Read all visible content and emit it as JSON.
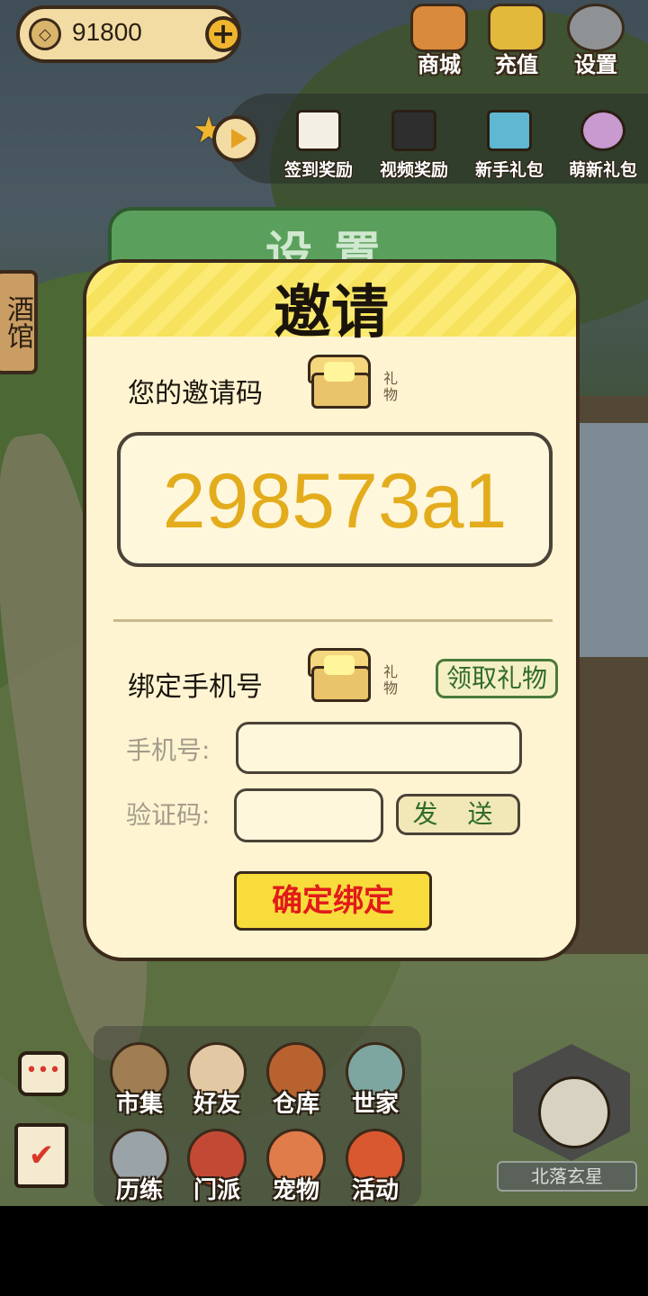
{
  "top_bar": {
    "coins": "91800",
    "coin_icon": "diamond-coin-icon",
    "buttons": [
      {
        "label": "商城",
        "icon": "shop-bag-icon"
      },
      {
        "label": "充值",
        "icon": "recharge-gold-icon"
      },
      {
        "label": "设置",
        "icon": "gear-icon"
      }
    ]
  },
  "rewards": [
    {
      "label": "签到奖励",
      "icon": "calendar-icon"
    },
    {
      "label": "视频奖励",
      "icon": "clapperboard-icon"
    },
    {
      "label": "新手礼包",
      "icon": "chest-icon"
    },
    {
      "label": "萌新礼包",
      "icon": "character-icon"
    }
  ],
  "side_sign": "酒馆",
  "settings_title": "设置",
  "dialog": {
    "title": "邀请",
    "invite_label": "您的邀请码",
    "gift_label": "礼物",
    "invite_code": "298573a1",
    "bind_label": "绑定手机号",
    "claim_button": "领取礼物",
    "phone_label": "手机号:",
    "phone_value": "",
    "code_label": "验证码:",
    "code_value": "",
    "send_button": "发 送",
    "confirm_button": "确定绑定"
  },
  "bottom_menu": [
    {
      "label": "市集",
      "icon": "market-icon"
    },
    {
      "label": "好友",
      "icon": "handshake-icon"
    },
    {
      "label": "仓库",
      "icon": "treasure-chest-icon"
    },
    {
      "label": "世家",
      "icon": "teapot-icon"
    },
    {
      "label": "历练",
      "icon": "crossed-swords-icon"
    },
    {
      "label": "门派",
      "icon": "clan-banner-icon"
    },
    {
      "label": "宠物",
      "icon": "paw-icon"
    },
    {
      "label": "活动",
      "icon": "lantern-icon"
    }
  ],
  "player": {
    "name": "北落玄星"
  },
  "colors": {
    "code": "#e3ac1c",
    "confirm_text": "#e21a1a",
    "header": "#f6e25c"
  }
}
